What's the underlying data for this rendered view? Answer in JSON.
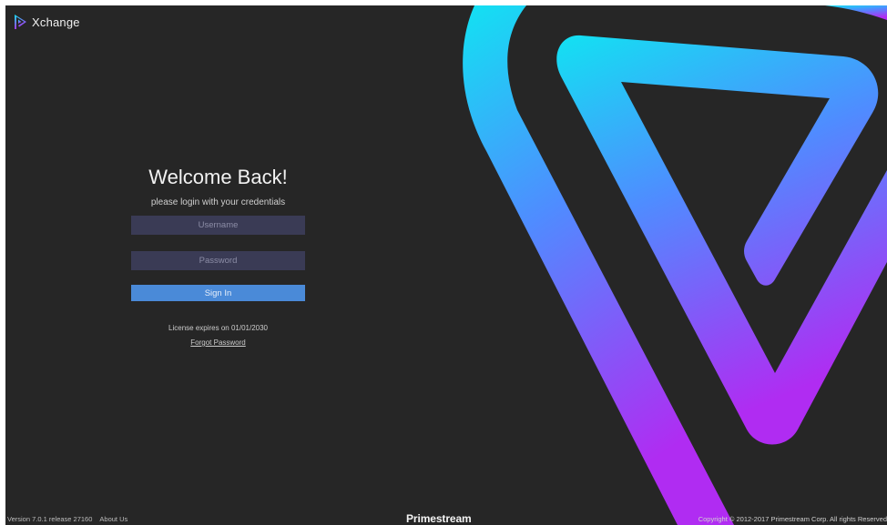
{
  "app": {
    "name": "Xchange",
    "icon": "xchange-logo-icon"
  },
  "login": {
    "heading": "Welcome Back!",
    "subtitle": "please login with your credentials",
    "username_placeholder": "Username",
    "username_value": "",
    "password_placeholder": "Password",
    "password_value": "",
    "sign_in_label": "Sign In",
    "license_text": "License expires on 01/01/2030",
    "forgot_password_label": "Forgot Password"
  },
  "footer": {
    "version": "Version 7.0.1 release 27160",
    "about_label": "About Us",
    "brand": "Primestream",
    "copyright": "Copyright © 2012-2017 Primestream Corp. All rights Reserved"
  },
  "colors": {
    "background": "#262626",
    "input_background": "#3a3b55",
    "button_background": "#4a8ad8",
    "gradient_start": "#12e2f2",
    "gradient_mid": "#4f8cff",
    "gradient_end": "#b02cf2"
  }
}
